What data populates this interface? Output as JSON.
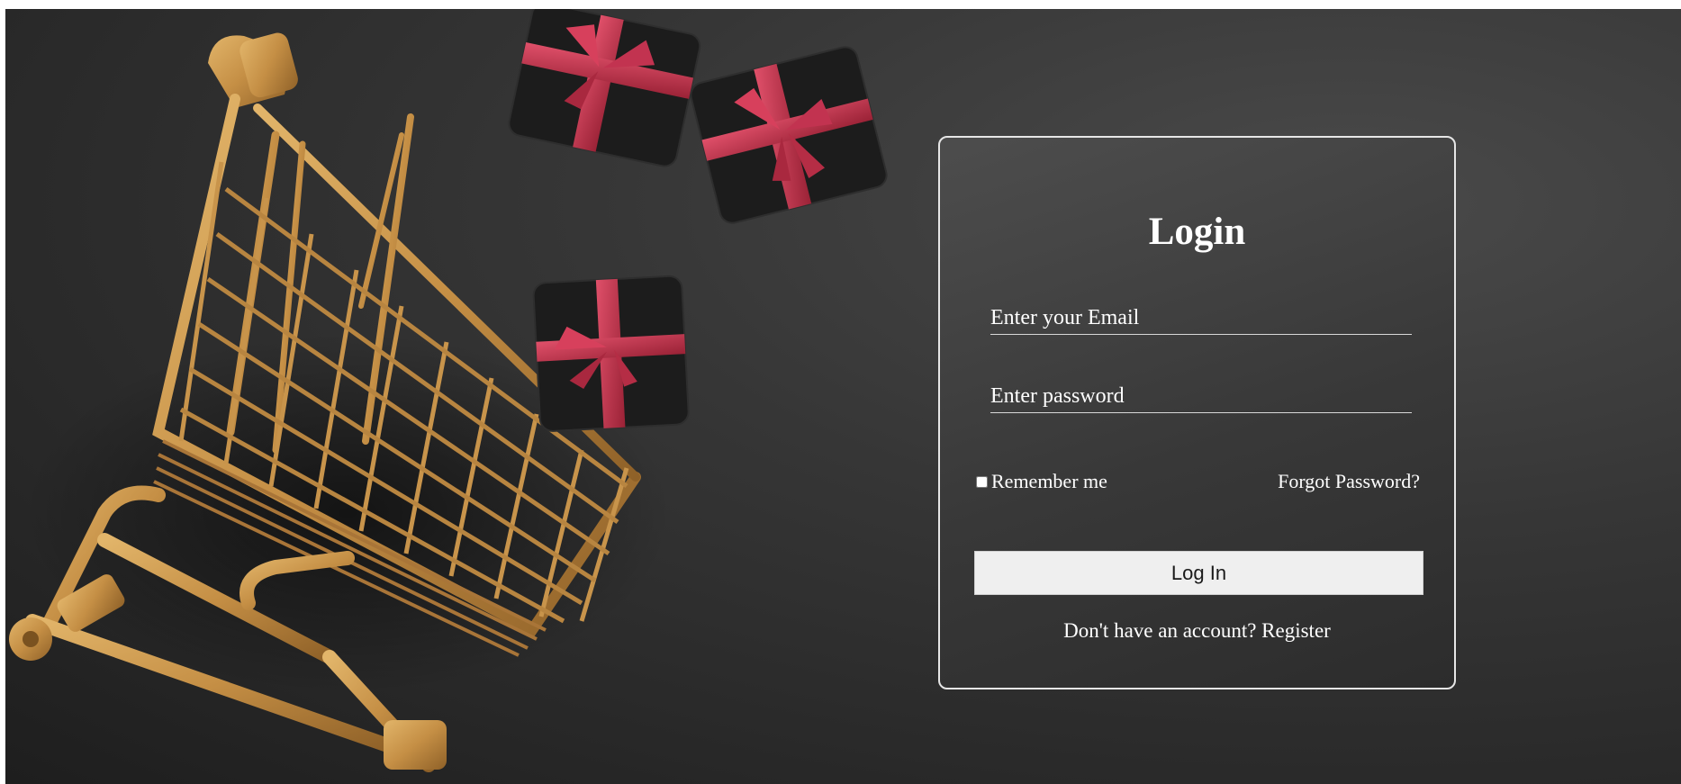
{
  "login": {
    "title": "Login",
    "email_placeholder": "Enter your Email",
    "password_placeholder": "Enter password",
    "remember_label": "Remember me",
    "forgot_label": "Forgot Password?",
    "submit_label": "Log In",
    "register_prompt": "Don't have an account?",
    "register_link": "Register"
  },
  "background": {
    "description_icons": [
      "shopping-cart-icon",
      "gift-box-icon"
    ],
    "colors": {
      "background_dark": "#2b2b2b",
      "cart_gold": "#c99a4e",
      "gift_black": "#1d1d1d",
      "ribbon_red": "#b8374a",
      "card_border": "#e6e6e6",
      "button_bg": "#efefef"
    }
  }
}
